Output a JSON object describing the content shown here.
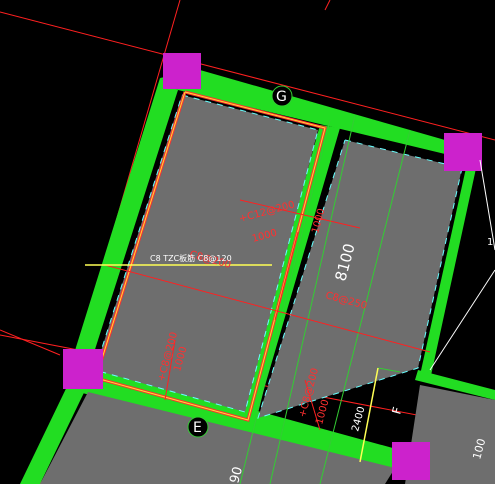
{
  "drawing": {
    "axis_labels": {
      "g": "G",
      "e": "E"
    },
    "dimensions": {
      "bay_width": "8100",
      "sub_dim_2400": "2400",
      "sub_dim_f": "F",
      "left_1000": "1000",
      "slab_1000": "1000",
      "right_1000": "1000",
      "bottom_90": "90",
      "right_100": "100",
      "edge_1": "1"
    },
    "rebar_labels": {
      "c12": "+C12@200",
      "c8_250": "C8@250",
      "c8_200": "C8@200",
      "c8_200_b": "+C8@200",
      "c8_200_c": "+C8@200",
      "left_1000_lbl": "1000",
      "dim_1000_a": "1000",
      "dim_1000_b": "1000"
    },
    "leader_note": "C8 TZC板筋 C8@120",
    "colors": {
      "background": "#000000",
      "slab_fill": "#6e6e6e",
      "beam_green": "#22dd22",
      "column_magenta": "#cc22cc",
      "grid_red": "#ff2020",
      "dim_green": "#33cc33",
      "leader_yellow": "#ffff55"
    }
  }
}
